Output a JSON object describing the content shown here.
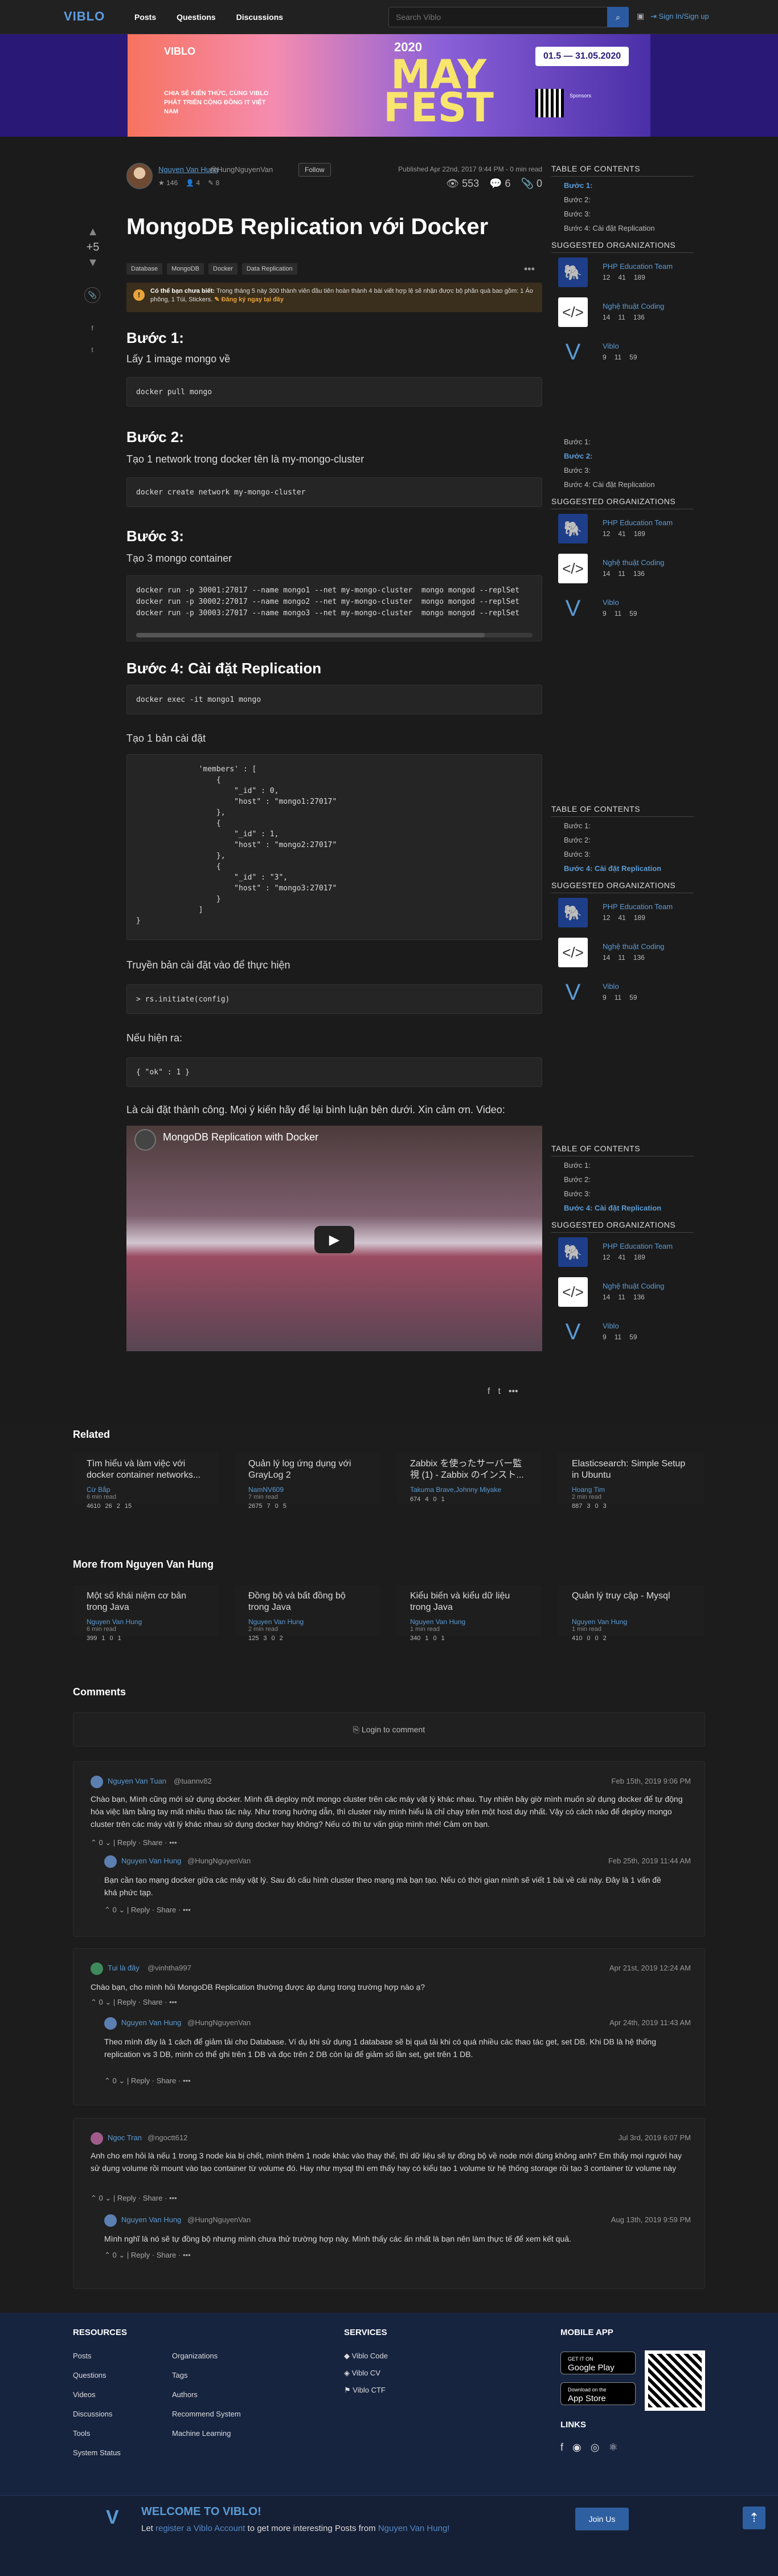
{
  "header": {
    "logo": "VIBLO",
    "nav": [
      "Posts",
      "Questions",
      "Discussions"
    ],
    "search_placeholder": "Search Viblo",
    "signin": "Sign In/Sign up"
  },
  "banner": {
    "brand": "VIBLO",
    "line": "CHIA SẺ KIẾN THỨC, CÙNG VIBLO PHÁT TRIỂN CỘNG ĐỒNG IT VIỆT NAM",
    "year": "2020",
    "title": "MAY FEST",
    "dates": "01.5 — 31.05.2020",
    "sponsors": "Sponsors"
  },
  "post": {
    "author": "Nguyen Van Hung",
    "handle": "@HungNguyenVan",
    "follow": "Follow",
    "author_stats": [
      "146",
      "4",
      "8"
    ],
    "published": "Published Apr 22nd, 2017 9:44 PM - 0 min read",
    "views": "553",
    "comments": "6",
    "clips": "0",
    "score": "+5",
    "title": "MongoDB Replication với Docker",
    "tags": [
      "Database",
      "MongoDB",
      "Docker",
      "Data Replication"
    ],
    "notice_bold": "Có thể bạn chưa biết:",
    "notice_text": "Trong tháng 5 này 300 thành viên đầu tiên hoàn thành 4 bài viết hợp lệ sẽ nhận được bộ phần quà bao gồm: 1 Áo phông, 1 Túi, Stickers.",
    "notice_link": "Đăng ký ngay tại đây",
    "s1": "Bước 1:",
    "p1": "Lấy 1 image mongo về",
    "c1": "docker pull mongo",
    "s2": "Bước 2:",
    "p2": "Tạo 1 network trong docker tên là my-mongo-cluster",
    "c2": "docker create network my-mongo-cluster",
    "s3": "Bước 3:",
    "p3": "Tạo 3 mongo container",
    "c3": "docker run -p 30001:27017 --name mongo1 --net my-mongo-cluster  mongo mongod --replSet\ndocker run -p 30002:27017 --name mongo2 --net my-mongo-cluster  mongo mongod --replSet\ndocker run -p 30003:27017 --name mongo3 --net my-mongo-cluster  mongo mongod --replSet",
    "s4": "Bước 4: Cài đặt Replication",
    "c4": "docker exec -it mongo1 mongo",
    "p5": "Tạo 1 bản cài đặt",
    "c5": "              'members' : [\n                  {\n                      \"_id\" : 0,\n                      \"host\" : \"mongo1:27017\"\n                  },\n                  {\n                      \"_id\" : 1,\n                      \"host\" : \"mongo2:27017\"\n                  },\n                  {\n                      \"_id\" : \"3\",\n                      \"host\" : \"mongo3:27017\"\n                  }\n              ]\n}",
    "p6": "Truyền bản cài đặt vào để thực hiện",
    "c6": "> rs.initiate(config)",
    "p7": "Nếu hiện ra:",
    "c7": "{ \"ok\" : 1 }",
    "p8": "Là cài đặt thành công. Mọi ý kiến hãy để lại bình luận bên dưới. Xin cảm ơn. Video:",
    "video_title": "MongoDB Replication with Docker"
  },
  "toc": {
    "title": "TABLE OF CONTENTS",
    "items": [
      "Bước 1:",
      "Bước 2:",
      "Bước 3:",
      "Bước 4: Cài đặt Replication"
    ],
    "orgs_title": "SUGGESTED ORGANIZATIONS",
    "orgs": [
      {
        "name": "PHP Education Team",
        "s": [
          "12",
          "41",
          "189"
        ]
      },
      {
        "name": "Nghệ thuật Coding",
        "s": [
          "14",
          "11",
          "136"
        ]
      },
      {
        "name": "Viblo",
        "s": [
          "9",
          "11",
          "59"
        ]
      }
    ]
  },
  "related": {
    "title": "Related",
    "cards": [
      {
        "t": "Tìm hiểu và làm việc với docker container networks...",
        "a": "Cừ Bắp",
        "r": "6 min read",
        "s": [
          "4610",
          "26",
          "2",
          "15"
        ]
      },
      {
        "t": "Quản lý log ứng dụng với GrayLog 2",
        "a": "NamNV609",
        "r": "7 min read",
        "s": [
          "2675",
          "7",
          "0",
          "5"
        ]
      },
      {
        "t": "Zabbix を使ったサーバー監視 (1) - Zabbix のインスト...",
        "a": "Takuma Brave,Johnny Miyake",
        "r": "",
        "s": [
          "674",
          "4",
          "0",
          "1"
        ]
      },
      {
        "t": "Elasticsearch: Simple Setup in Ubuntu",
        "a": "Hoang Tim",
        "r": "2 min read",
        "s": [
          "887",
          "3",
          "0",
          "3"
        ]
      }
    ]
  },
  "more": {
    "title": "More from Nguyen Van Hung",
    "cards": [
      {
        "t": "Một số khái niệm cơ bản trong Java",
        "a": "Nguyen Van Hung",
        "r": "6 min read",
        "s": [
          "399",
          "1",
          "0",
          "1"
        ]
      },
      {
        "t": "Đồng bộ và bất đồng bộ trong Java",
        "a": "Nguyen Van Hung",
        "r": "2 min read",
        "s": [
          "125",
          "3",
          "0",
          "2"
        ]
      },
      {
        "t": "Kiểu biến và kiểu dữ liệu trong Java",
        "a": "Nguyen Van Hung",
        "r": "1 min read",
        "s": [
          "340",
          "1",
          "0",
          "1"
        ]
      },
      {
        "t": "Quản lý truy cập - Mysql",
        "a": "Nguyen Van Hung",
        "r": "1 min read",
        "s": [
          "410",
          "0",
          "0",
          "2"
        ]
      }
    ]
  },
  "comments": {
    "title": "Comments",
    "login": "Login to comment",
    "reply": "Reply",
    "share": "Share",
    "list": [
      {
        "n": "Nguyen Van Tuan",
        "h": "@tuannv82",
        "d": "Feb 15th, 2019 9:06 PM",
        "b": "Chào bạn, Mình cũng mới sử dụng docker. Mình đã deploy một mongo cluster trên các máy vật lý khác nhau. Tuy nhiên bây giờ mình muốn sử dụng docker để tự động hóa việc làm bằng tay mất nhiều thao tác này. Như trong hướng dẫn, thì cluster này mình hiểu là chỉ chạy trên một host duy nhất. Vậy có cách nào để deploy mongo cluster trên các máy vật lý khác nhau sử dụng docker hay không? Nếu có thì tư vấn giúp mình nhé! Cảm ơn bạn."
      },
      {
        "n": "Nguyen Van Hung",
        "h": "@HungNguyenVan",
        "d": "Feb 25th, 2019 11:44 AM",
        "b": "Bạn cần tạo mạng docker giữa các máy vật lý. Sau đó cấu hình cluster theo mạng mà bạn tạo. Nếu có thời gian mình sẽ viết 1 bài về cái này. Đây là 1 vấn đề khá phức tạp."
      },
      {
        "n": "Tui là đây",
        "h": "@vinhtha997",
        "d": "Apr 21st, 2019 12:24 AM",
        "b": "Chào bạn, cho mình hỏi MongoDB Replication thường được áp dụng trong trường hợp nào ạ?"
      },
      {
        "n": "Nguyen Van Hung",
        "h": "@HungNguyenVan",
        "d": "Apr 24th, 2019 11:43 AM",
        "b": "Theo mình đây là 1 cách để giảm tải cho Database. Ví dụ khi sử dụng 1 database sẽ bị quá tải khi có quá nhiều các thao tác get, set DB. Khi DB là hệ thống replication vs 3 DB, mình có thể ghi trên 1 DB và đọc trên 2 DB còn lại để giảm số lần set, get trên 1 DB."
      },
      {
        "n": "Ngoc Tran",
        "h": "@ngoctt612",
        "d": "Jul 3rd, 2019 6:07 PM",
        "b": "Anh cho em hỏi là nếu 1 trong 3 node kia bị chết, mình thêm 1 node khác vào thay thế, thì dữ liệu sẽ tự đồng bộ về node mới đúng không anh? Em thấy mọi người hay sử dụng volume rồi mount vào tạo container từ volume đó. Hay như mysql thì em thấy hay có kiểu tạo 1 volume từ hệ thống storage rồi tạo 3 container từ volume này"
      },
      {
        "n": "Nguyen Van Hung",
        "h": "@HungNguyenVan",
        "d": "Aug 13th, 2019 9:59 PM",
        "b": "Mình nghĩ là nó sẽ tự đồng bộ nhưng mình chưa thử trường hợp này. Mình thấy các ấn nhất là bạn nên làm thực tế để xem kết quả."
      }
    ]
  },
  "footer": {
    "resources": "RESOURCES",
    "res_col1": [
      "Posts",
      "Questions",
      "Videos",
      "Discussions",
      "Tools",
      "System Status"
    ],
    "res_col2": [
      "Organizations",
      "Tags",
      "Authors",
      "Recommend System",
      "Machine Learning"
    ],
    "services": "SERVICES",
    "svc": [
      "Viblo Code",
      "Viblo CV",
      "Viblo CTF"
    ],
    "mobile": "MOBILE APP",
    "gp_small": "GET IT ON",
    "gp": "Google Play",
    "as_small": "Download on the",
    "as": "App Store",
    "links": "LINKS",
    "welcome": "WELCOME TO VIBLO!",
    "welcome_sub_1": "Let",
    "welcome_link_1": "register a Viblo Account",
    "welcome_sub_2": "to get more interesting Posts from",
    "welcome_link_2": "Nguyen Van Hung!",
    "join": "Join Us"
  },
  "colors": {
    "accent": "#5b9bd5",
    "bg": "#1b1b1b",
    "footer": "#172440"
  }
}
